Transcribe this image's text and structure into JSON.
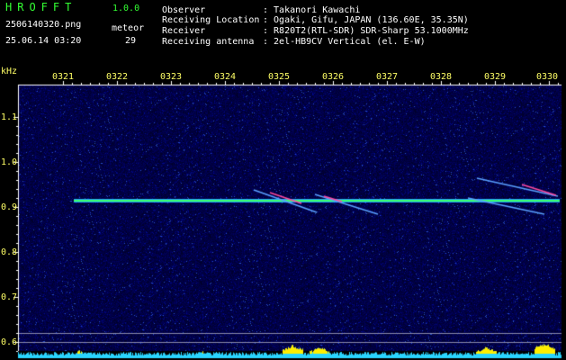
{
  "app": {
    "brand": "HROFFT",
    "version": "1.0.0"
  },
  "file": {
    "filename": "2506140320.png",
    "datetime": "25.06.14 03:20"
  },
  "meteor": {
    "label": "meteor",
    "count": "29"
  },
  "info": [
    {
      "key": "Observer",
      "value": ": Takanori Kawachi"
    },
    {
      "key": "Receiving Location",
      "value": ": Ogaki, Gifu, JAPAN (136.60E, 35.35N)"
    },
    {
      "key": "Receiver",
      "value": ": R820T2(RTL-SDR) SDR-Sharp 53.1000MHz"
    },
    {
      "key": "Receiving antenna",
      "value": ": 2el-HB9CV Vertical (el. E-W)"
    }
  ],
  "yaxis": {
    "unit": "kHz",
    "ticks": [
      "1.1",
      "1.0",
      "0.9",
      "0.8",
      "0.7",
      "0.6"
    ]
  },
  "xaxis": {
    "ticks": [
      "0321",
      "0322",
      "0323",
      "0324",
      "0325",
      "0326",
      "0327",
      "0328",
      "0329",
      "0330"
    ]
  },
  "colors": {
    "background": "#000000",
    "noise_low": "#0a0a5a",
    "carrier": "#3cff6a",
    "meteor_head": "#ff4aa0",
    "signal_bar": "#2ad4ff",
    "signal_peak": "#ffee00",
    "axis_text": "#ffff66",
    "header_text": "#ffffff",
    "brand_text": "#33ff33"
  }
}
